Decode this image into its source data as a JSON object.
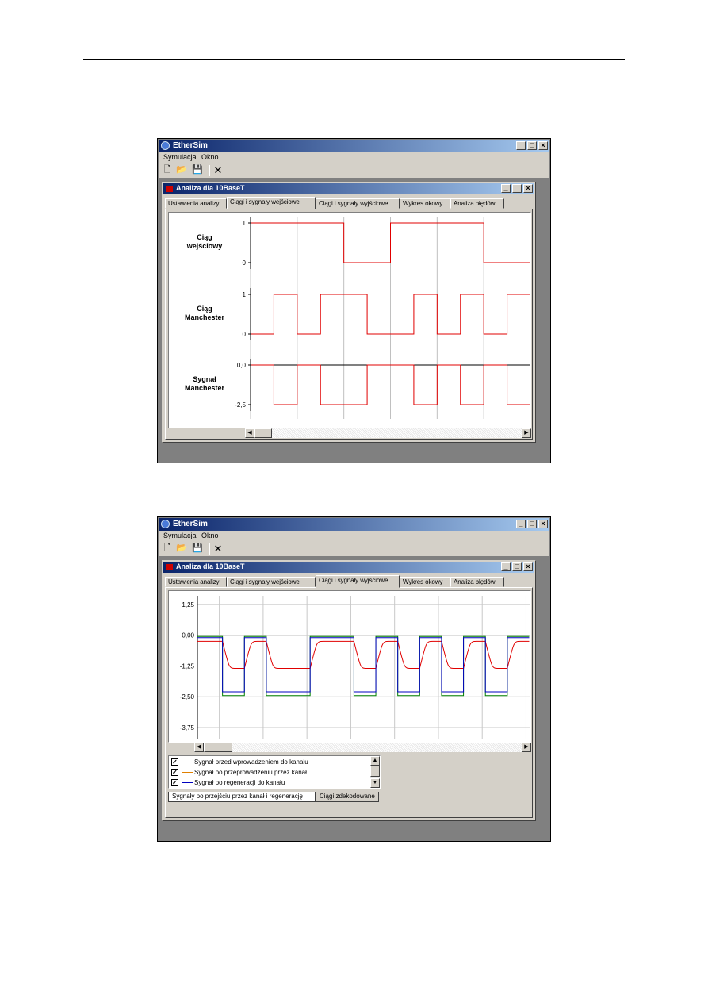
{
  "app_title": "EtherSim",
  "menu": [
    "Symulacja",
    "Okno"
  ],
  "child_title": "Analiza dla 10BaseT",
  "tabs": [
    "Ustawienia analizy",
    "Ciągi i sygnały wejściowe",
    "Ciągi i sygnały wyjściowe",
    "Wykres okowy",
    "Analiza błędów"
  ],
  "window1": {
    "active_tab_index": 1,
    "labels": {
      "input_seq": [
        "Ciąg",
        "wejściowy"
      ],
      "manchester_seq": [
        "Ciąg",
        "Manchester"
      ],
      "manchester_sig": [
        "Sygnał",
        "Manchester"
      ]
    },
    "ticks": {
      "input_seq": [
        "1",
        "0"
      ],
      "manchester_seq": [
        "1",
        "0"
      ],
      "manchester_sig": [
        "0,0",
        "-2,5"
      ]
    },
    "colors": {
      "signal": "#e00000",
      "baseline": "#000000",
      "grid": "#c0c0c0"
    }
  },
  "window2": {
    "active_tab_index": 2,
    "y_ticks": [
      "1,25",
      "0,00",
      "-1,25",
      "-2,50",
      "-3,75"
    ],
    "legend": [
      {
        "label": "Sygnał przed wprowadzeniem do kanału",
        "color": "#008000",
        "checked": true
      },
      {
        "label": "Sygnał po przeprowadzeniu przez kanał",
        "color": "#e00000",
        "checked": true
      },
      {
        "label": "Sygnał po regeneracji do kanału",
        "color": "#0000c0",
        "checked": true
      }
    ],
    "bottom_tabs": [
      "Sygnały po przejściu przez kanał i regenerację",
      "Ciągi zdekodowane"
    ]
  },
  "chart_data": [
    {
      "type": "line",
      "title": "",
      "series": [
        {
          "name": "Ciąg wejściowy",
          "x": [
            0,
            1,
            2,
            3,
            4,
            5,
            6
          ],
          "values": [
            1,
            1,
            0,
            1,
            1,
            0,
            0
          ]
        },
        {
          "name": "Ciąg Manchester",
          "x": [
            0,
            0.5,
            1,
            1.5,
            2,
            2.5,
            3,
            3.5,
            4,
            4.5,
            5,
            5.5,
            6
          ],
          "values": [
            0,
            1,
            0,
            1,
            1,
            0,
            0,
            1,
            0,
            1,
            0,
            1,
            0
          ]
        },
        {
          "name": "Sygnał Manchester",
          "x": [
            0,
            0.5,
            1,
            1.5,
            2,
            2.5,
            3,
            3.5,
            4,
            4.5,
            5,
            5.5,
            6
          ],
          "values": [
            0,
            -2.5,
            0,
            -2.5,
            -2.5,
            0,
            0,
            -2.5,
            0,
            -2.5,
            0,
            -2.5,
            0
          ]
        }
      ]
    },
    {
      "type": "line",
      "title": "",
      "ylim": [
        -4.2,
        1.6
      ],
      "series": [
        {
          "name": "Sygnał przed wprowadzeniem do kanału",
          "color": "#008000",
          "bits": [
            0,
            1,
            0,
            1,
            1,
            0,
            0,
            1,
            0,
            1,
            0,
            1,
            0,
            1,
            0
          ],
          "low": -2.45,
          "high": -0.05
        },
        {
          "name": "Sygnał po przeprowadzeniu przez kanał",
          "color": "#e00000",
          "bits": [
            0,
            1,
            0,
            1,
            1,
            0,
            0,
            1,
            0,
            1,
            0,
            1,
            0,
            1,
            0
          ],
          "low": -1.35,
          "high": -0.25
        },
        {
          "name": "Sygnał po regeneracji do kanału",
          "color": "#0000c0",
          "bits": [
            0,
            1,
            0,
            1,
            1,
            0,
            0,
            1,
            0,
            1,
            0,
            1,
            0,
            1,
            0
          ],
          "low": -2.3,
          "high": -0.1
        }
      ]
    }
  ]
}
